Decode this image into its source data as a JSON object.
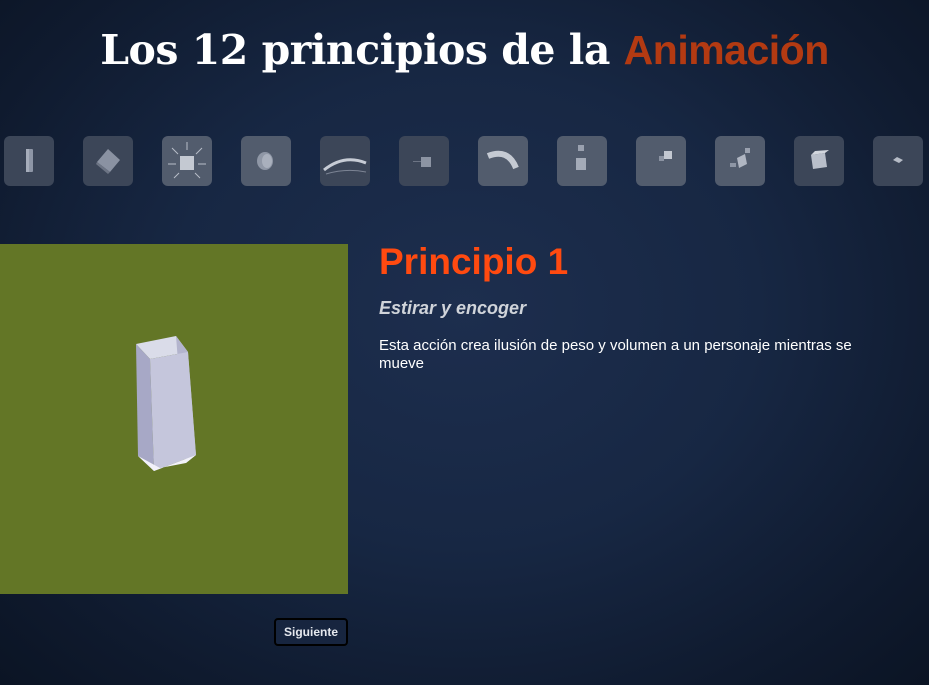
{
  "page": {
    "title_main": "Los 12 principios de la ",
    "title_accent": "Animación"
  },
  "thumbnails": [
    {
      "icon": "stretch-box-icon",
      "selected": true
    },
    {
      "icon": "rotated-cube-icon"
    },
    {
      "icon": "burst-cube-icon"
    },
    {
      "icon": "sphere-icon"
    },
    {
      "icon": "arc-icon"
    },
    {
      "icon": "small-box-icon"
    },
    {
      "icon": "curved-arrow-icon"
    },
    {
      "icon": "stacked-boxes-icon"
    },
    {
      "icon": "offset-boxes-icon"
    },
    {
      "icon": "scattered-shapes-icon"
    },
    {
      "icon": "solid-cube-icon"
    },
    {
      "icon": "tiny-diamond-icon"
    }
  ],
  "principle": {
    "heading": "Principio 1",
    "name": "Estirar y encoger",
    "description": "Esta acción crea ilusión de peso y volumen a un personaje mientras se mueve"
  },
  "navigation": {
    "next_label": "Siguiente"
  },
  "colors": {
    "stage_background": "#637626",
    "heading": "#ff4a10",
    "title_accent": "#b33a12"
  }
}
